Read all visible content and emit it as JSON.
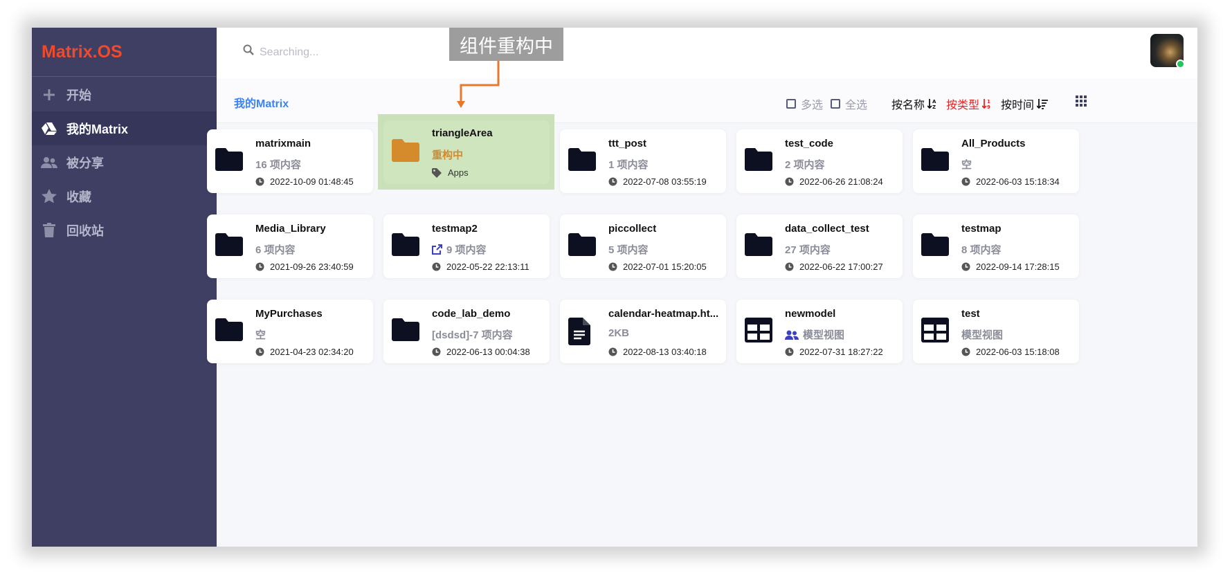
{
  "app": {
    "logo": "Matrix.OS"
  },
  "sidebar": {
    "items": [
      {
        "label": "开始",
        "icon": "plus-icon",
        "active": false
      },
      {
        "label": "我的Matrix",
        "icon": "drive-icon",
        "active": true
      },
      {
        "label": "被分享",
        "icon": "users-icon",
        "active": false
      },
      {
        "label": "收藏",
        "icon": "star-icon",
        "active": false
      },
      {
        "label": "回收站",
        "icon": "trash-icon",
        "active": false
      }
    ]
  },
  "search": {
    "placeholder": "Searching...",
    "value": ""
  },
  "banner": {
    "text": "组件重构中"
  },
  "breadcrumb": {
    "label": "我的Matrix"
  },
  "toolbar": {
    "multi_select": "多选",
    "select_all": "全选",
    "sort_name": "按名称",
    "sort_type": "按类型",
    "sort_time": "按时间"
  },
  "colors": {
    "sidebar": "#3e3f62",
    "accent_blue": "#3b82f6",
    "logo": "#ef4a2d",
    "active_sort": "#ef2020",
    "highlight": "#c9e0b8",
    "folder_orange": "#d58a2c",
    "arrow": "#e8782c"
  },
  "items": [
    {
      "name": "matrixmain",
      "meta": "16 项内容",
      "time": "2022-10-09 01:48:45",
      "icon": "folder-icon"
    },
    {
      "name": "triangleArea",
      "meta": "重构中",
      "tag": "Apps",
      "icon": "folder-icon",
      "highlighted": true
    },
    {
      "name": "ttt_post",
      "meta": "1 项内容",
      "time": "2022-07-08 03:55:19",
      "icon": "folder-icon"
    },
    {
      "name": "test_code",
      "meta": "2 项内容",
      "time": "2022-06-26 21:08:24",
      "icon": "folder-icon"
    },
    {
      "name": "All_Products",
      "meta": "空",
      "time": "2022-06-03 15:18:34",
      "icon": "folder-icon"
    },
    {
      "name": "Media_Library",
      "meta": "6 项内容",
      "time": "2021-09-26 23:40:59",
      "icon": "folder-icon"
    },
    {
      "name": "testmap2",
      "meta": "9 项内容",
      "meta_icon": "external-link-icon",
      "time": "2022-05-22 22:13:11",
      "icon": "folder-icon"
    },
    {
      "name": "piccollect",
      "meta": "5 项内容",
      "time": "2022-07-01 15:20:05",
      "icon": "folder-icon"
    },
    {
      "name": "data_collect_test",
      "meta": "27 项内容",
      "time": "2022-06-22 17:00:27",
      "icon": "folder-icon"
    },
    {
      "name": "testmap",
      "meta": "8 项内容",
      "time": "2022-09-14 17:28:15",
      "icon": "folder-icon"
    },
    {
      "name": "MyPurchases",
      "meta": "空",
      "time": "2021-04-23 02:34:20",
      "icon": "folder-icon"
    },
    {
      "name": "code_lab_demo",
      "meta": "[dsdsd]-7 项内容",
      "time": "2022-06-13 00:04:38",
      "icon": "folder-icon"
    },
    {
      "name": "calendar-heatmap.ht...",
      "meta": "2KB",
      "time": "2022-08-13 03:40:18",
      "icon": "file-icon"
    },
    {
      "name": "newmodel",
      "meta": "模型视图",
      "meta_icon": "users-icon",
      "time": "2022-07-31 18:27:22",
      "icon": "table-icon"
    },
    {
      "name": "test",
      "meta": "模型视图",
      "time": "2022-06-03 15:18:08",
      "icon": "table-icon"
    }
  ]
}
